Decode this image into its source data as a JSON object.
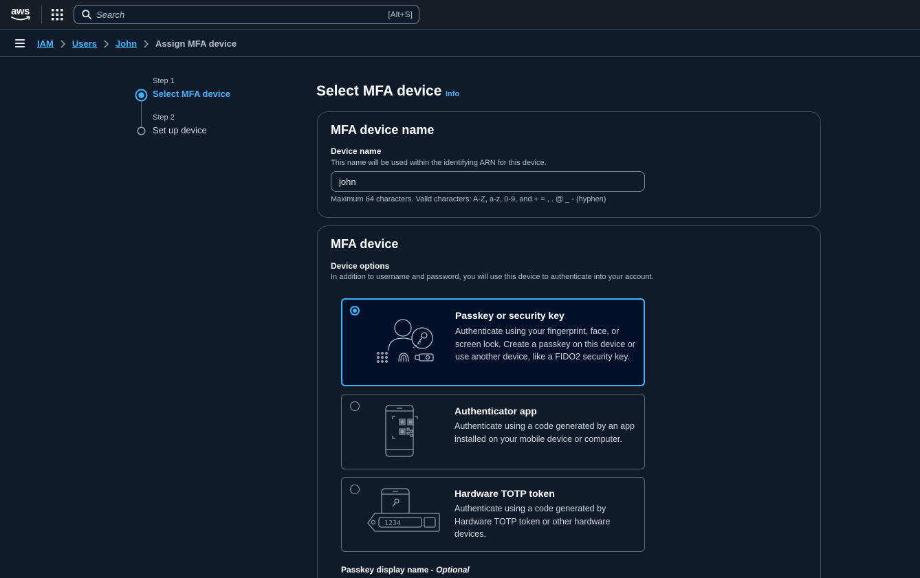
{
  "topnav": {
    "logo_text": "aws",
    "search_placeholder": "Search",
    "search_shortcut": "[Alt+S]"
  },
  "breadcrumb": {
    "items": [
      "IAM",
      "Users",
      "John"
    ],
    "current": "Assign MFA device"
  },
  "steps": [
    {
      "label": "Step 1",
      "title": "Select MFA device",
      "active": true
    },
    {
      "label": "Step 2",
      "title": "Set up device",
      "active": false
    }
  ],
  "page": {
    "title": "Select MFA device",
    "info_link": "Info"
  },
  "name_panel": {
    "title": "MFA device name",
    "label": "Device name",
    "description": "This name will be used within the identifying ARN for this device.",
    "value": "john",
    "constraint": "Maximum 64 characters. Valid characters: A-Z, a-z, 0-9, and + = , . @ _ - (hyphen)"
  },
  "device_panel": {
    "title": "MFA device",
    "label": "Device options",
    "description": "In addition to username and password, you will use this device to authenticate into your account.",
    "options": [
      {
        "title": "Passkey or security key",
        "description": "Authenticate using your fingerprint, face, or screen lock. Create a passkey on this device or use another device, like a FIDO2 security key.",
        "selected": true
      },
      {
        "title": "Authenticator app",
        "description": "Authenticate using a code generated by an app installed on your mobile device or computer.",
        "selected": false
      },
      {
        "title": "Hardware TOTP token",
        "description": "Authenticate using a code generated by Hardware TOTP token or other hardware devices.",
        "selected": false,
        "illustration_text": "1234"
      }
    ],
    "display_name_label": "Passkey display name",
    "display_name_optional": "- Optional"
  },
  "colors": {
    "background": "#0f1b2a",
    "accent": "#42b4ff",
    "selected_card_bg": "#001129",
    "border": "#414d5c"
  }
}
